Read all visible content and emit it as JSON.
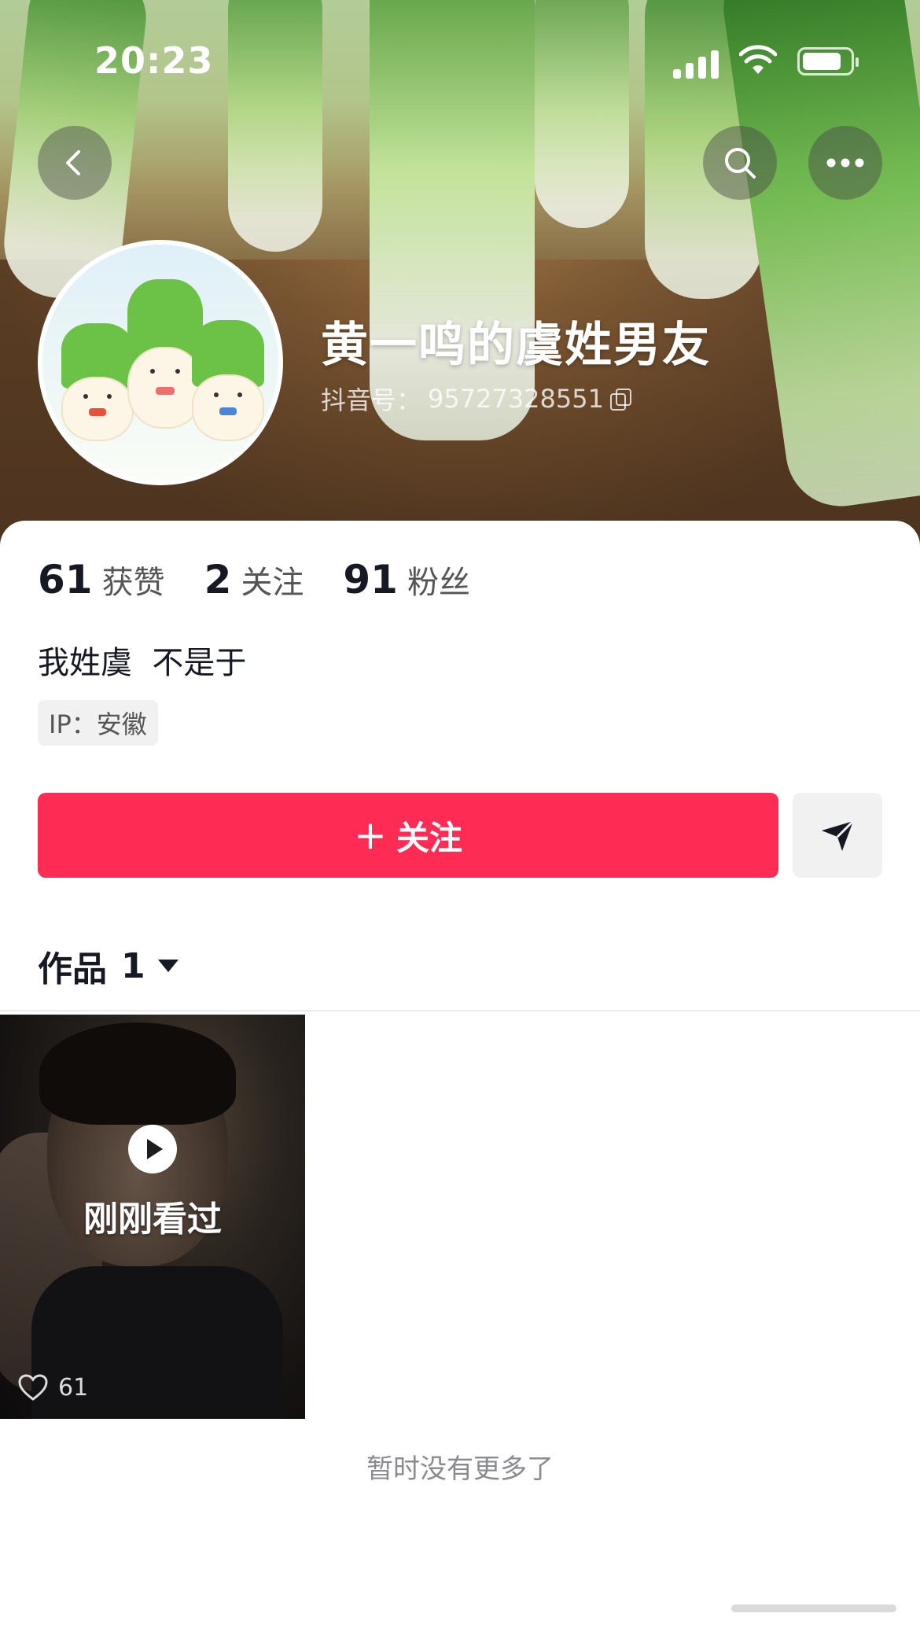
{
  "status_bar": {
    "time": "20:23"
  },
  "header": {
    "name": "黄一鸣的虞姓男友",
    "douyin_id_label": "抖音号：",
    "douyin_id": "95727328551"
  },
  "stats": [
    {
      "value": "61",
      "label": "获赞"
    },
    {
      "value": "2",
      "label": "关注"
    },
    {
      "value": "91",
      "label": "粉丝"
    }
  ],
  "bio": "我姓虞  不是于",
  "ip_tag": "IP：安徽",
  "follow_button": {
    "plus": "+",
    "label": "关注"
  },
  "works_tab": {
    "label": "作品",
    "count": "1"
  },
  "video": {
    "status": "刚刚看过",
    "likes": "61"
  },
  "footer_text": "暂时没有更多了",
  "colors": {
    "accent": "#fe2c55",
    "text": "#161823",
    "secondary": "#8a8b91"
  }
}
